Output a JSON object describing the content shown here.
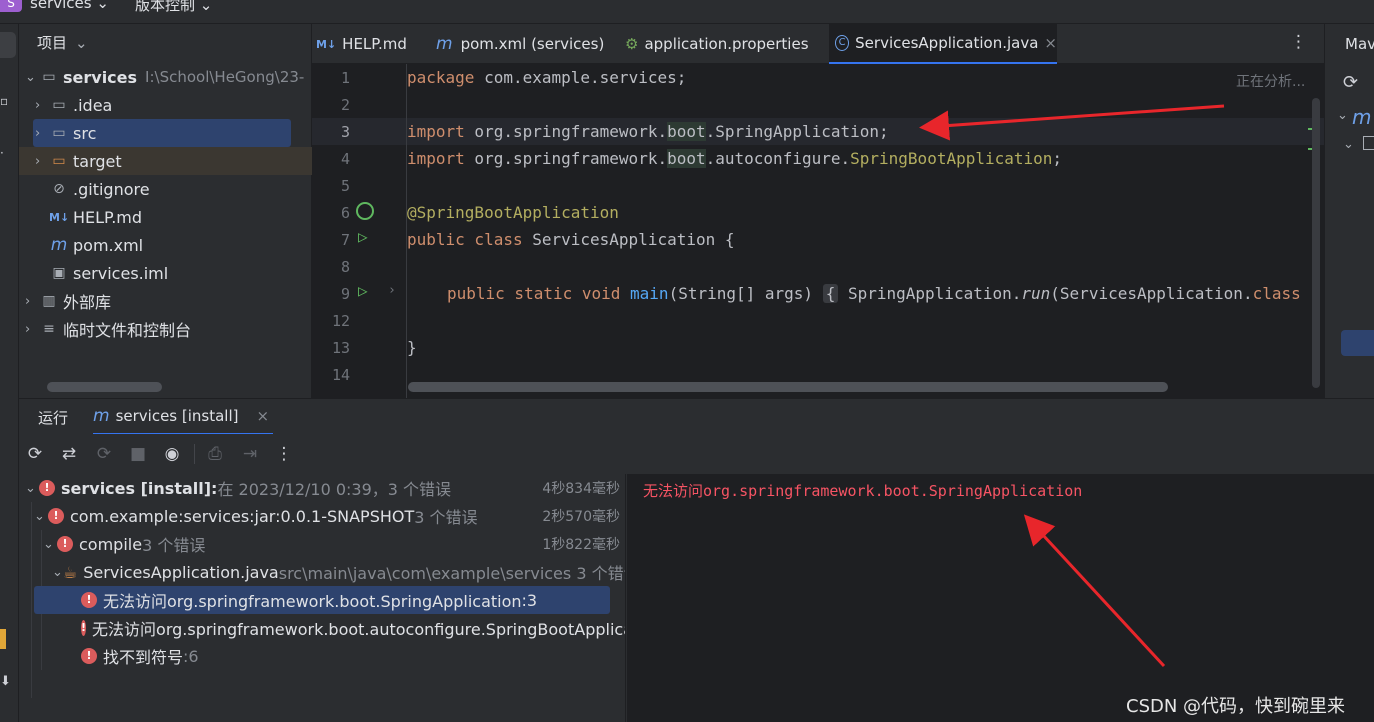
{
  "topbar": {
    "project": "services",
    "vcs": "版本控制",
    "project_badge": "S"
  },
  "project_panel": {
    "title": "项目",
    "items": [
      {
        "label": "services",
        "path": "I:\\School\\HeGong\\23-",
        "icon": "folder-icon"
      },
      {
        "label": ".idea",
        "icon": "folder-icon"
      },
      {
        "label": "src",
        "icon": "folder-icon"
      },
      {
        "label": "target",
        "icon": "folder-icon"
      },
      {
        "label": ".gitignore",
        "icon": "ignore-icon"
      },
      {
        "label": "HELP.md",
        "icon": "markdown-icon",
        "icon_text": "M↓"
      },
      {
        "label": "pom.xml",
        "icon": "maven-icon",
        "icon_text": "m"
      },
      {
        "label": "services.iml",
        "icon": "iml-icon"
      },
      {
        "label": "外部库",
        "icon": "library-icon"
      },
      {
        "label": "临时文件和控制台",
        "icon": "scratch-icon"
      }
    ]
  },
  "tabs": [
    {
      "label": "HELP.md",
      "icon_text": "M↓"
    },
    {
      "label": "pom.xml (services)",
      "icon_text": "m"
    },
    {
      "label": "application.properties",
      "icon_text": "⚙"
    },
    {
      "label": "ServicesApplication.java",
      "icon_text": "C"
    }
  ],
  "editor": {
    "status": "正在分析...",
    "line_numbers": [
      "1",
      "2",
      "3",
      "4",
      "5",
      "6",
      "7",
      "8",
      "9",
      "12",
      "13",
      "14"
    ],
    "code": {
      "l1_kw": "package",
      "l1_rest": " com.example.services;",
      "l3_kw": "import",
      "l3_a": " org.springframework.",
      "l3_b": "boot",
      ".": "",
      "l3_c": ".SpringApplication;",
      "l4_kw": "import",
      "l4_a": " org.springframework.",
      "l4_b": "boot",
      "l4_c": ".autoconfigure.",
      "l4_d": "SpringBootApplication",
      "l4_e": ";",
      "l6": "@SpringBootApplication",
      "l7_kw": "public class",
      "l7_rest": " ServicesApplication {",
      "l9_kw": "public static void",
      "l9_m": " main",
      "l9_a": "(String[] args)",
      "l9_b": "{",
      "l9_c": " SpringApplication.",
      "l9_d": "run",
      "l9_e": "(ServicesApplication.",
      "l9_f": "class",
      "l13": "}"
    }
  },
  "maven": {
    "title": "Mav",
    "m": "m"
  },
  "run": {
    "tab_run": "运行",
    "tab_label": "services [install]",
    "tree": [
      {
        "label": "services [install]:",
        "detail": " 在 2023/12/10 0:39，3 个错误",
        "time": "4秒834毫秒"
      },
      {
        "label": "com.example:services:jar:0.0.1-SNAPSHOT",
        "detail": "  3 个错误",
        "time": "2秒570毫秒"
      },
      {
        "label": "compile",
        "detail": "  3 个错误",
        "time": "1秒822毫秒"
      },
      {
        "label": "ServicesApplication.java",
        "detail": " src\\main\\java\\com\\example\\services 3 个错误"
      },
      {
        "label": "无法访问org.springframework.boot.SpringApplication",
        "detail": " :3"
      },
      {
        "label": "无法访问org.springframework.boot.autoconfigure.SpringBootApplica",
        "detail": ""
      },
      {
        "label": "找不到符号",
        "detail": " :6"
      }
    ]
  },
  "console": {
    "message": "无法访问org.springframework.boot.SpringApplication"
  },
  "watermark": "CSDN @代码，快到碗里来",
  "colors": {
    "accent": "#3574f0",
    "error": "#db5c5c",
    "selection": "#2e436e",
    "arrow": "#e8262b"
  }
}
